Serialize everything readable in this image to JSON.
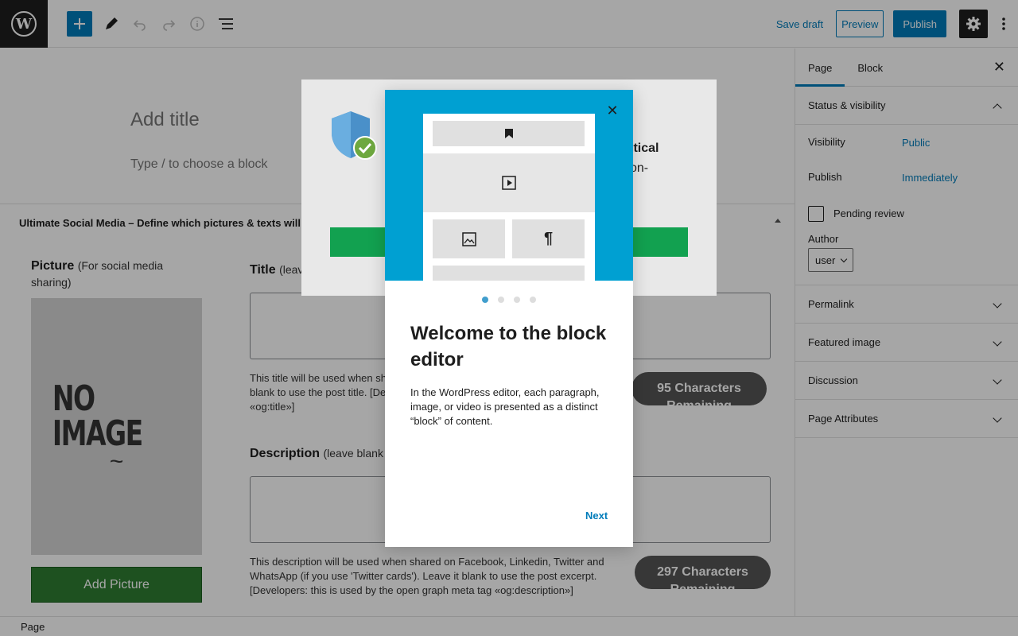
{
  "toolbar": {
    "save_draft": "Save draft",
    "preview": "Preview",
    "publish": "Publish"
  },
  "editor": {
    "title_placeholder": "Add title",
    "block_placeholder": "Type / to choose a block"
  },
  "meta_box": {
    "heading": "Ultimate Social Media – Define which pictures & texts will g",
    "picture_label": "Picture",
    "picture_sub": "(For social media sharing)",
    "no_image": "NO IMAGE",
    "add_picture": "Add Picture",
    "title_label": "Title",
    "title_sub": "(leav",
    "title_help": "This title will be used when sh… blank to use the post title. [Dev… «og:title»]",
    "title_help_l1": "This title will be used when sh",
    "title_help_l2": "blank to use the post title. [Dev",
    "title_help_l3": "«og:title»]",
    "title_counter": "95 Characters Remaining",
    "desc_label": "Description",
    "desc_sub": "(leave blank t",
    "desc_help_l1": "This description will be used when shared on Facebook, Linkedin, Twitter and",
    "desc_help_l2": "WhatsApp (if you use 'Twitter cards'). Leave it blank to use the post excerpt.",
    "desc_help_l3": "[Developers: this is used by the open graph meta tag «og:description»]",
    "desc_counter": "297 Characters Remaining"
  },
  "sidebar": {
    "tab_page": "Page",
    "tab_block": "Block",
    "status_visibility": "Status & visibility",
    "visibility_label": "Visibility",
    "visibility_value": "Public",
    "publish_label": "Publish",
    "publish_value": "Immediately",
    "pending_review": "Pending review",
    "author_label": "Author",
    "author_value": "user",
    "panels": [
      "Permalink",
      "Featured image",
      "Discussion",
      "Page Attributes"
    ]
  },
  "plugin_modal": {
    "heading_partial": "itical",
    "text_partial": "on-"
  },
  "guide": {
    "title": "Welcome to the block editor",
    "text": "In the WordPress editor, each paragraph, image, or video is presented as a distinct “block” of content.",
    "next": "Next",
    "dots_total": 4,
    "dots_active": 1
  },
  "footer": {
    "breadcrumb": "Page"
  },
  "colors": {
    "accent": "#007cba",
    "guide_hero": "#00a0d2",
    "add_picture": "#2e7d32"
  }
}
